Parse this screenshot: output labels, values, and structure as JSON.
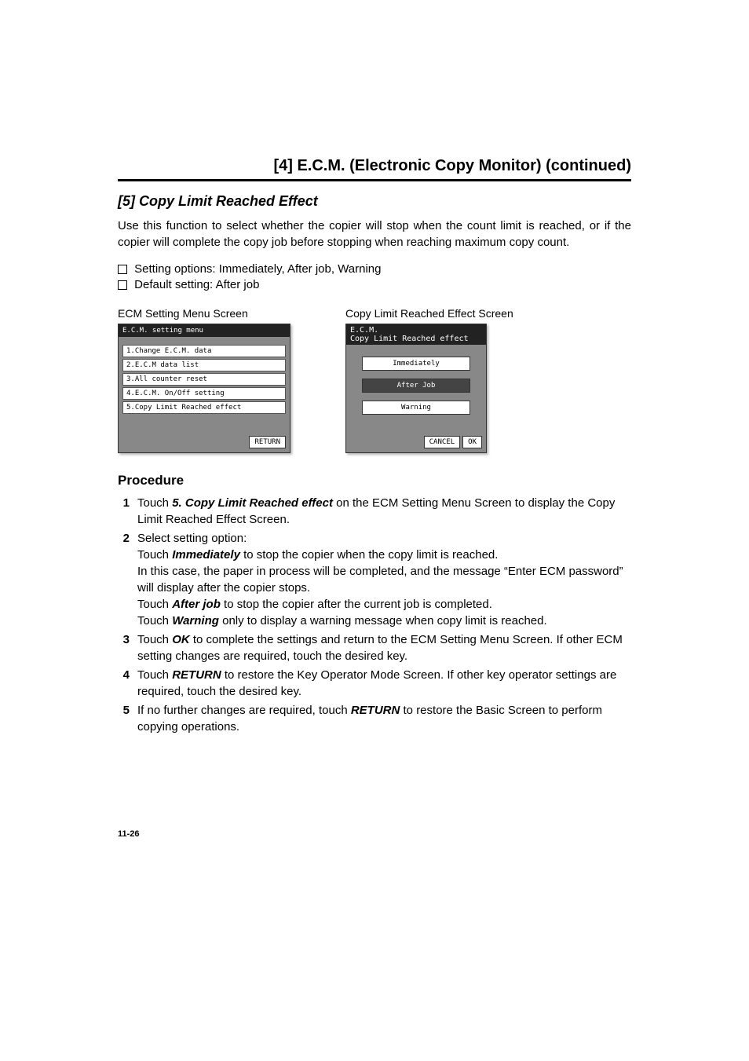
{
  "header": {
    "title": "[4] E.C.M. (Electronic Copy Monitor) (continued)"
  },
  "subsection": {
    "title": "[5] Copy Limit Reached Effect",
    "description": "Use this function to select whether the copier will stop when the count limit is reached, or if the copier will complete the copy job before stopping when reaching maximum copy count."
  },
  "options": {
    "line1": "Setting options: Immediately, After job, Warning",
    "line2": "Default setting: After job"
  },
  "screens": {
    "menu": {
      "label": "ECM Setting Menu Screen",
      "title": "E.C.M. setting menu",
      "items": [
        "1.Change E.C.M. data",
        "2.E.C.M data list",
        "3.All counter reset",
        "4.E.C.M. On/Off setting",
        "5.Copy Limit Reached effect"
      ],
      "return": "RETURN"
    },
    "effect": {
      "label": "Copy Limit Reached Effect Screen",
      "title": "E.C.M.",
      "subtitle": "Copy Limit Reached effect",
      "options": [
        {
          "label": "Immediately",
          "selected": false
        },
        {
          "label": "After Job",
          "selected": true
        },
        {
          "label": "Warning",
          "selected": false
        }
      ],
      "cancel": "CANCEL",
      "ok": "OK"
    }
  },
  "procedure": {
    "title": "Procedure",
    "steps": [
      {
        "num": "1",
        "parts": [
          {
            "text": "Touch ",
            "style": "normal"
          },
          {
            "text": "5. Copy Limit Reached effect",
            "style": "bi"
          },
          {
            "text": " on the ECM Setting Menu Screen to display the Copy Limit Reached Effect Screen.",
            "style": "normal"
          }
        ]
      },
      {
        "num": "2",
        "parts": [
          {
            "text": "Select setting option:",
            "style": "normal"
          },
          {
            "break": true
          },
          {
            "text": "Touch ",
            "style": "normal"
          },
          {
            "text": "Immediately",
            "style": "bi"
          },
          {
            "text": " to stop the copier when the copy limit is reached.",
            "style": "normal"
          },
          {
            "break": true
          },
          {
            "text": "In this case, the paper in process will be completed, and the message “Enter ECM password” will display after the copier stops.",
            "style": "normal"
          },
          {
            "break": true
          },
          {
            "text": "Touch ",
            "style": "normal"
          },
          {
            "text": "After job",
            "style": "bi"
          },
          {
            "text": " to stop the copier after the current job is completed.",
            "style": "normal"
          },
          {
            "break": true
          },
          {
            "text": "Touch ",
            "style": "normal"
          },
          {
            "text": "Warning",
            "style": "bi"
          },
          {
            "text": " only to display a warning message when copy limit is reached.",
            "style": "normal"
          }
        ]
      },
      {
        "num": "3",
        "parts": [
          {
            "text": "Touch ",
            "style": "normal"
          },
          {
            "text": "OK",
            "style": "bi"
          },
          {
            "text": " to complete the settings and return to the ECM Setting Menu Screen. If other ECM setting changes are required, touch the desired key.",
            "style": "normal"
          }
        ]
      },
      {
        "num": "4",
        "parts": [
          {
            "text": "Touch ",
            "style": "normal"
          },
          {
            "text": "RETURN",
            "style": "bi"
          },
          {
            "text": " to restore the Key Operator Mode Screen. If other key operator settings are required, touch the desired key.",
            "style": "normal"
          }
        ]
      },
      {
        "num": "5",
        "parts": [
          {
            "text": "If no further changes are required, touch ",
            "style": "normal"
          },
          {
            "text": "RETURN",
            "style": "bi"
          },
          {
            "text": " to restore the Basic Screen to perform copying operations.",
            "style": "normal"
          }
        ]
      }
    ]
  },
  "pageNum": "11-26"
}
